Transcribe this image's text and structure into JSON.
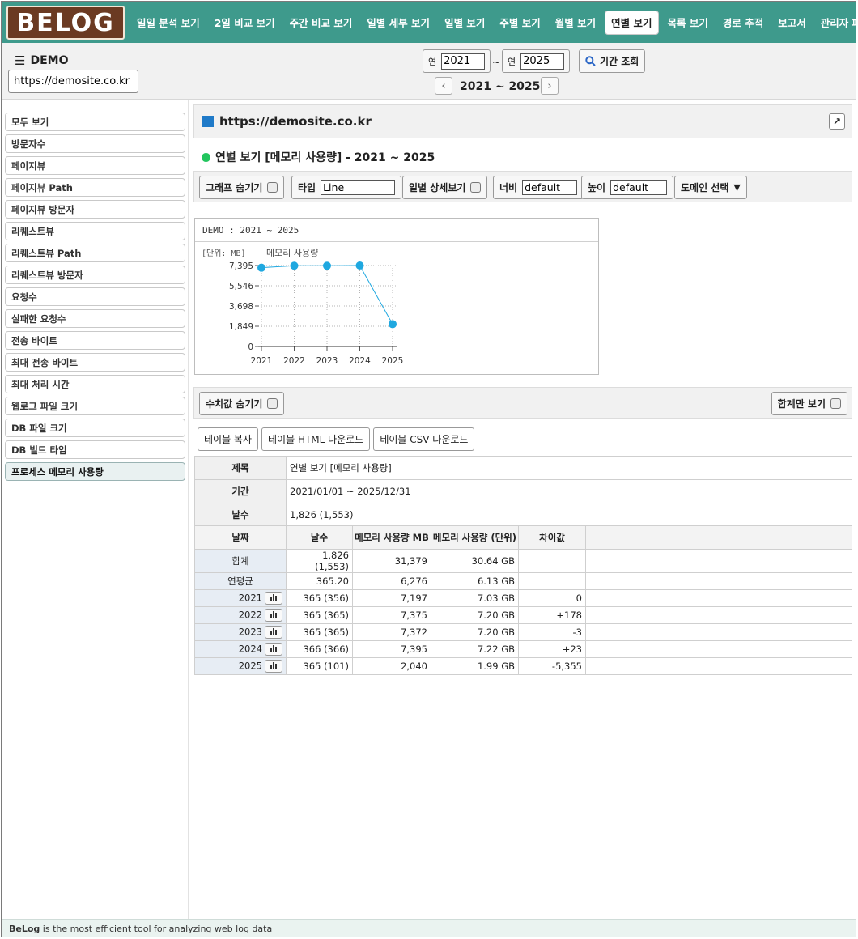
{
  "brand": {
    "logo_text": "BELOG"
  },
  "nav": {
    "items": [
      "일일 분석 보기",
      "2일 비교 보기",
      "주간 비교 보기",
      "일별 세부 보기",
      "일별 보기",
      "주별 보기",
      "월별 보기",
      "연별 보기",
      "목록 보기",
      "경로 추적",
      "보고서",
      "관리자 페이지"
    ],
    "active_index": 7
  },
  "header": {
    "site_name": "DEMO",
    "site_url": "https://demosite.co.kr",
    "year_label": "연",
    "year_from": "2021",
    "year_to": "2025",
    "tilde": "~",
    "search_label": "기간 조회",
    "range_label": "2021 ~ 2025"
  },
  "sidebar": {
    "items": [
      "모두 보기",
      "방문자수",
      "페이지뷰",
      "페이지뷰 Path",
      "페이지뷰 방문자",
      "리퀘스트뷰",
      "리퀘스트뷰 Path",
      "리퀘스트뷰 방문자",
      "요청수",
      "실패한 요청수",
      "전송 바이트",
      "최대 전송 바이트",
      "최대 처리 시간",
      "웹로그 파일 크기",
      "DB 파일 크기",
      "DB 빌드 타임",
      "프로세스 메모리 사용량"
    ],
    "active_index": 16
  },
  "main": {
    "url_title": "https://demosite.co.kr",
    "subtitle": "연별 보기 [메모리 사용량] - 2021 ~ 2025",
    "toolbar": {
      "hide_graph": "그래프 숨기기",
      "type_label": "타입",
      "type_value": "Line",
      "daily_detail": "일별 상세보기",
      "width_label": "너비",
      "width_value": "default",
      "height_label": "높이",
      "height_value": "default",
      "domain_select": "도메인 선택"
    },
    "options": {
      "hide_values": "수치값 숨기기",
      "total_only": "합계만 보기"
    },
    "buttons": [
      "테이블 복사",
      "테이블 HTML 다운로드",
      "테이블 CSV 다운로드"
    ]
  },
  "chart_data": {
    "type": "line",
    "title": "DEMO : 2021 ~ 2025",
    "unit_label": "[단위: MB]",
    "x": [
      "2021",
      "2022",
      "2023",
      "2024",
      "2025"
    ],
    "series": [
      {
        "name": "메모리 사용량",
        "values": [
          7197,
          7375,
          7372,
          7395,
          2040
        ]
      }
    ],
    "yticks": [
      "0",
      "1,849",
      "3,698",
      "5,546",
      "7,395"
    ],
    "ylim": [
      0,
      7395
    ],
    "grid": true,
    "line_color": "#1fa8e0"
  },
  "info_table": [
    {
      "label": "제목",
      "value": "연별 보기 [메모리 사용량]"
    },
    {
      "label": "기간",
      "value": "2021/01/01 ~ 2025/12/31"
    },
    {
      "label": "날수",
      "value": "1,826 (1,553)"
    }
  ],
  "data_table": {
    "headers": [
      "날짜",
      "날수",
      "메모리 사용량 MB",
      "메모리 사용량 (단위)",
      "차이값",
      ""
    ],
    "rows": [
      [
        "합계",
        "1,826 (1,553)",
        "31,379",
        "30.64 GB",
        ""
      ],
      [
        "연평균",
        "365.20",
        "6,276",
        "6.13 GB",
        ""
      ],
      [
        "2021",
        "365 (356)",
        "7,197",
        "7.03 GB",
        "0"
      ],
      [
        "2022",
        "365 (365)",
        "7,375",
        "7.20 GB",
        "+178"
      ],
      [
        "2023",
        "365 (365)",
        "7,372",
        "7.20 GB",
        "-3"
      ],
      [
        "2024",
        "366 (366)",
        "7,395",
        "7.22 GB",
        "+23"
      ],
      [
        "2025",
        "365 (101)",
        "2,040",
        "1.99 GB",
        "-5,355"
      ]
    ]
  },
  "footer": {
    "brand": "BeLog",
    "text": " is the most efficient tool for analyzing web log data"
  }
}
